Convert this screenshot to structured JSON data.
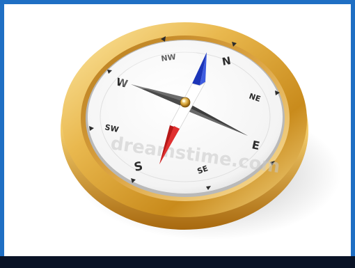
{
  "image": {
    "subject": "compass",
    "colors": {
      "frame": "#1f6fc4",
      "bottom_strip": "#0a1326",
      "gold": "#e3b24a",
      "needle_north": "#1f3fc7",
      "needle_south": "#c71f1f"
    }
  },
  "compass": {
    "north": "N",
    "northeast": "NE",
    "east": "E",
    "southeast": "SE",
    "south": "S",
    "southwest": "SW",
    "west": "W",
    "northwest": "NW"
  },
  "watermark": "dreamstime.com"
}
